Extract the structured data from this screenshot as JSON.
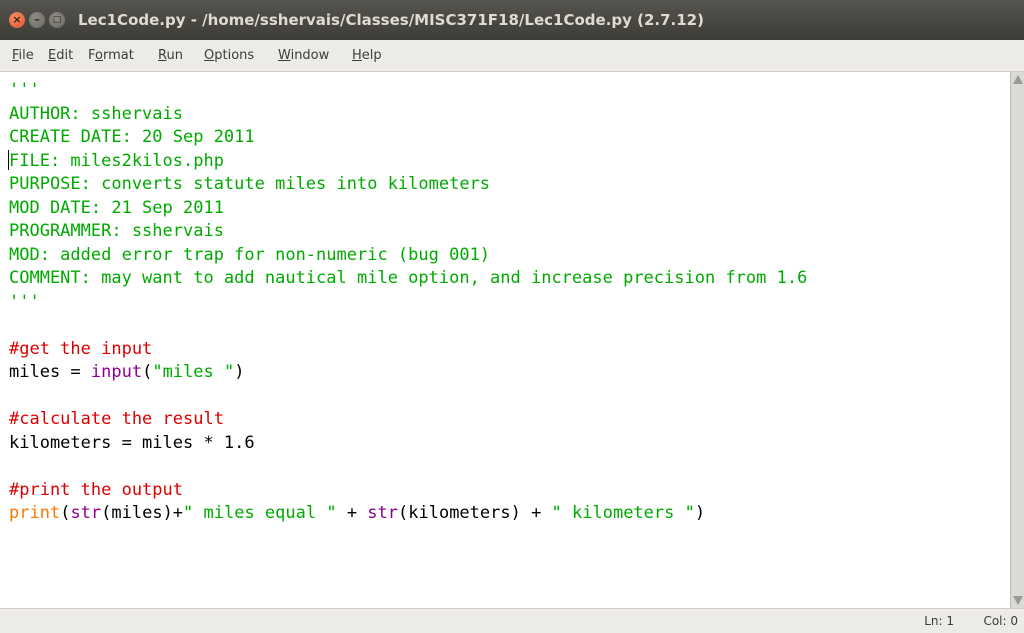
{
  "window": {
    "title": "Lec1Code.py - /home/sshervais/Classes/MISC371F18/Lec1Code.py (2.7.12)",
    "close_glyph": "×",
    "min_glyph": "–",
    "max_glyph": "□"
  },
  "menu": [
    {
      "key": "F",
      "rest": "ile"
    },
    {
      "key": "E",
      "rest": "dit"
    },
    {
      "pre": "F",
      "key": "o",
      "rest": "rmat"
    },
    {
      "key": "R",
      "rest": "un"
    },
    {
      "key": "O",
      "rest": "ptions"
    },
    {
      "key": "W",
      "rest": "indow"
    },
    {
      "key": "H",
      "rest": "elp"
    }
  ],
  "code": [
    [
      {
        "t": "s",
        "v": "'''"
      }
    ],
    [
      {
        "t": "s",
        "v": "AUTHOR: sshervais"
      }
    ],
    [
      {
        "t": "s",
        "v": "CREATE DATE: 20 Sep 2011"
      }
    ],
    [
      {
        "t": "s",
        "v": "FILE: miles2kilos.php"
      }
    ],
    [
      {
        "t": "s",
        "v": "PURPOSE: converts statute miles into kilometers"
      }
    ],
    [
      {
        "t": "s",
        "v": "MOD DATE: 21 Sep 2011"
      }
    ],
    [
      {
        "t": "s",
        "v": "PROGRAMMER: sshervais"
      }
    ],
    [
      {
        "t": "s",
        "v": "MOD: added error trap for non-numeric (bug 001)"
      }
    ],
    [
      {
        "t": "s",
        "v": "COMMENT: may want to add nautical mile option, and increase precision from 1.6"
      }
    ],
    [
      {
        "t": "s",
        "v": "'''"
      }
    ],
    [],
    [
      {
        "t": "c",
        "v": "#get the input"
      }
    ],
    [
      {
        "t": "n",
        "v": "miles = "
      },
      {
        "t": "b",
        "v": "input"
      },
      {
        "t": "n",
        "v": "("
      },
      {
        "t": "s",
        "v": "\"miles \""
      },
      {
        "t": "n",
        "v": ")"
      }
    ],
    [],
    [
      {
        "t": "c",
        "v": "#calculate the result"
      }
    ],
    [
      {
        "t": "n",
        "v": "kilometers = miles * 1.6"
      }
    ],
    [],
    [
      {
        "t": "c",
        "v": "#print the output"
      }
    ],
    [
      {
        "t": "k",
        "v": "print"
      },
      {
        "t": "n",
        "v": "("
      },
      {
        "t": "b",
        "v": "str"
      },
      {
        "t": "n",
        "v": "(miles)+"
      },
      {
        "t": "s",
        "v": "\" miles equal \""
      },
      {
        "t": "n",
        "v": " + "
      },
      {
        "t": "b",
        "v": "str"
      },
      {
        "t": "n",
        "v": "(kilometers) + "
      },
      {
        "t": "s",
        "v": "\" kilometers \""
      },
      {
        "t": "n",
        "v": ")"
      }
    ]
  ],
  "status": {
    "ln": "Ln: 1",
    "col": "Col: 0"
  },
  "colors": {
    "string": "#00aa00",
    "comment": "#dd0000",
    "keyword": "#ff7700",
    "builtin": "#900090",
    "text": "#000000"
  }
}
